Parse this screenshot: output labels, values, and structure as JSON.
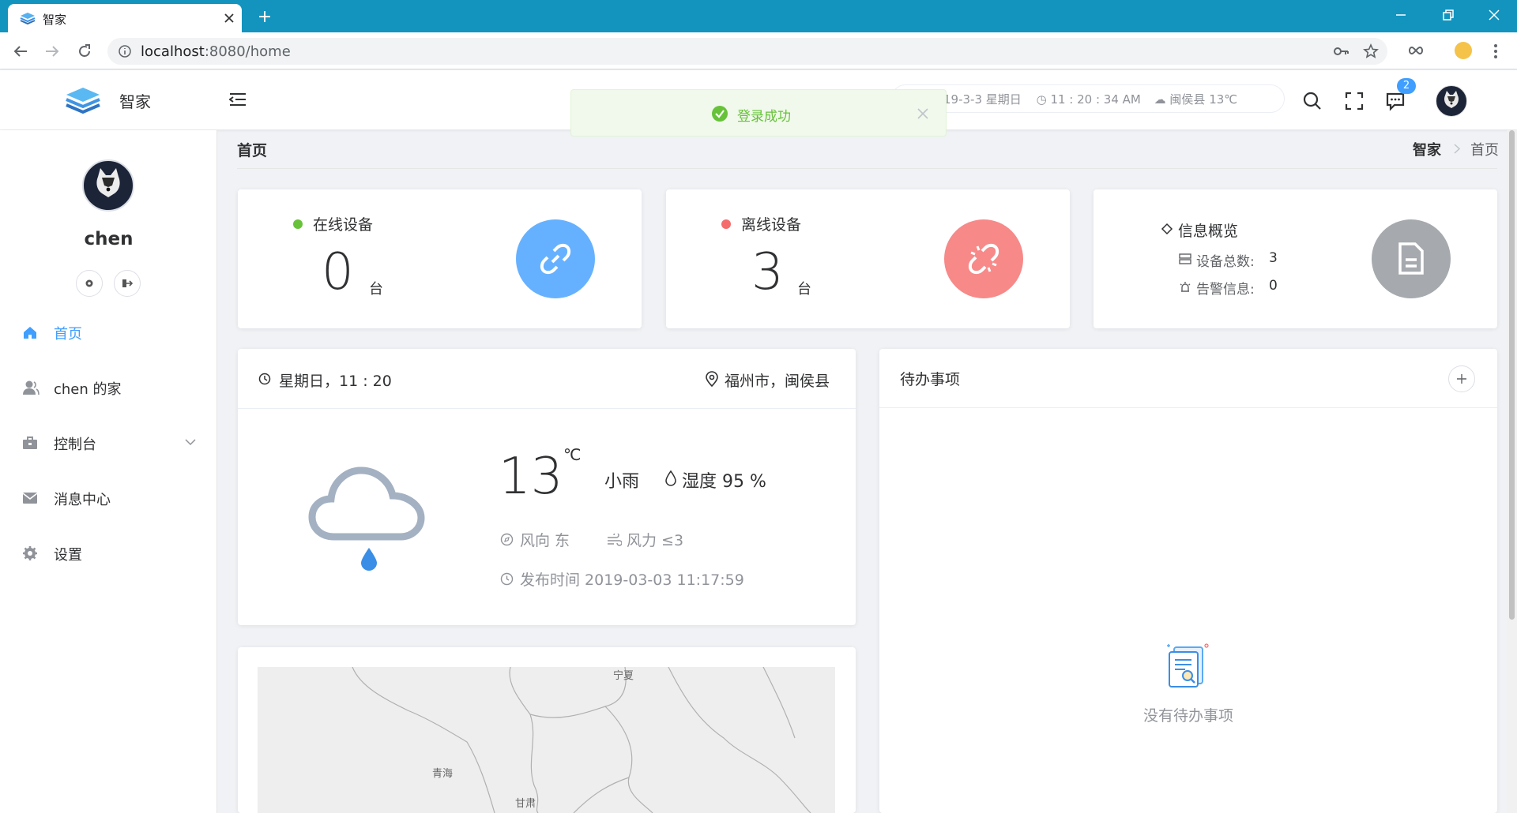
{
  "browser": {
    "tab_title": "智家",
    "url_host": "localhost",
    "url_path": ":8080/home"
  },
  "header": {
    "brand": "智家",
    "date": "19-3-3 星期日",
    "time": "11 : 20 : 34 AM",
    "weather": "闽侯县  13℃",
    "notification_count": "2"
  },
  "toast": {
    "message": "登录成功"
  },
  "sidebar": {
    "username": "chen",
    "items": [
      {
        "label": "首页",
        "icon": "home-icon",
        "active": true
      },
      {
        "label": "chen 的家",
        "icon": "user-icon"
      },
      {
        "label": "控制台",
        "icon": "briefcase-icon"
      },
      {
        "label": "消息中心",
        "icon": "mail-icon"
      },
      {
        "label": "设置",
        "icon": "gear-icon"
      }
    ]
  },
  "page": {
    "title": "首页",
    "breadcrumb": [
      "智家",
      "首页"
    ]
  },
  "stats": {
    "online": {
      "label": "在线设备",
      "value": "0",
      "unit": "台",
      "color": "#67c23a"
    },
    "offline": {
      "label": "离线设备",
      "value": "3",
      "unit": "台",
      "color": "#f56c6c"
    },
    "overview": {
      "label": "信息概览",
      "total_label": "设备总数:",
      "total_value": "3",
      "alarm_label": "告警信息:",
      "alarm_value": "0"
    }
  },
  "weather": {
    "day_time": "星期日，11 : 20",
    "location": "福州市，闽侯县",
    "temperature": "13",
    "temp_unit": "℃",
    "condition": "小雨",
    "humidity": "湿度 95 %",
    "wind_direction": "风向 东",
    "wind_power": "风力 ≤3",
    "publish_time": "发布时间 2019-03-03 11:17:59"
  },
  "map": {
    "labels": [
      "宁夏",
      "青海",
      "甘肃"
    ]
  },
  "todo": {
    "title": "待办事项",
    "empty": "没有待办事项"
  },
  "colors": {
    "accent": "#409eff",
    "tabbar": "#1294bf",
    "online_circle": "#66b1ff",
    "offline_circle": "#f78989",
    "overview_circle": "#a6a9ad"
  }
}
